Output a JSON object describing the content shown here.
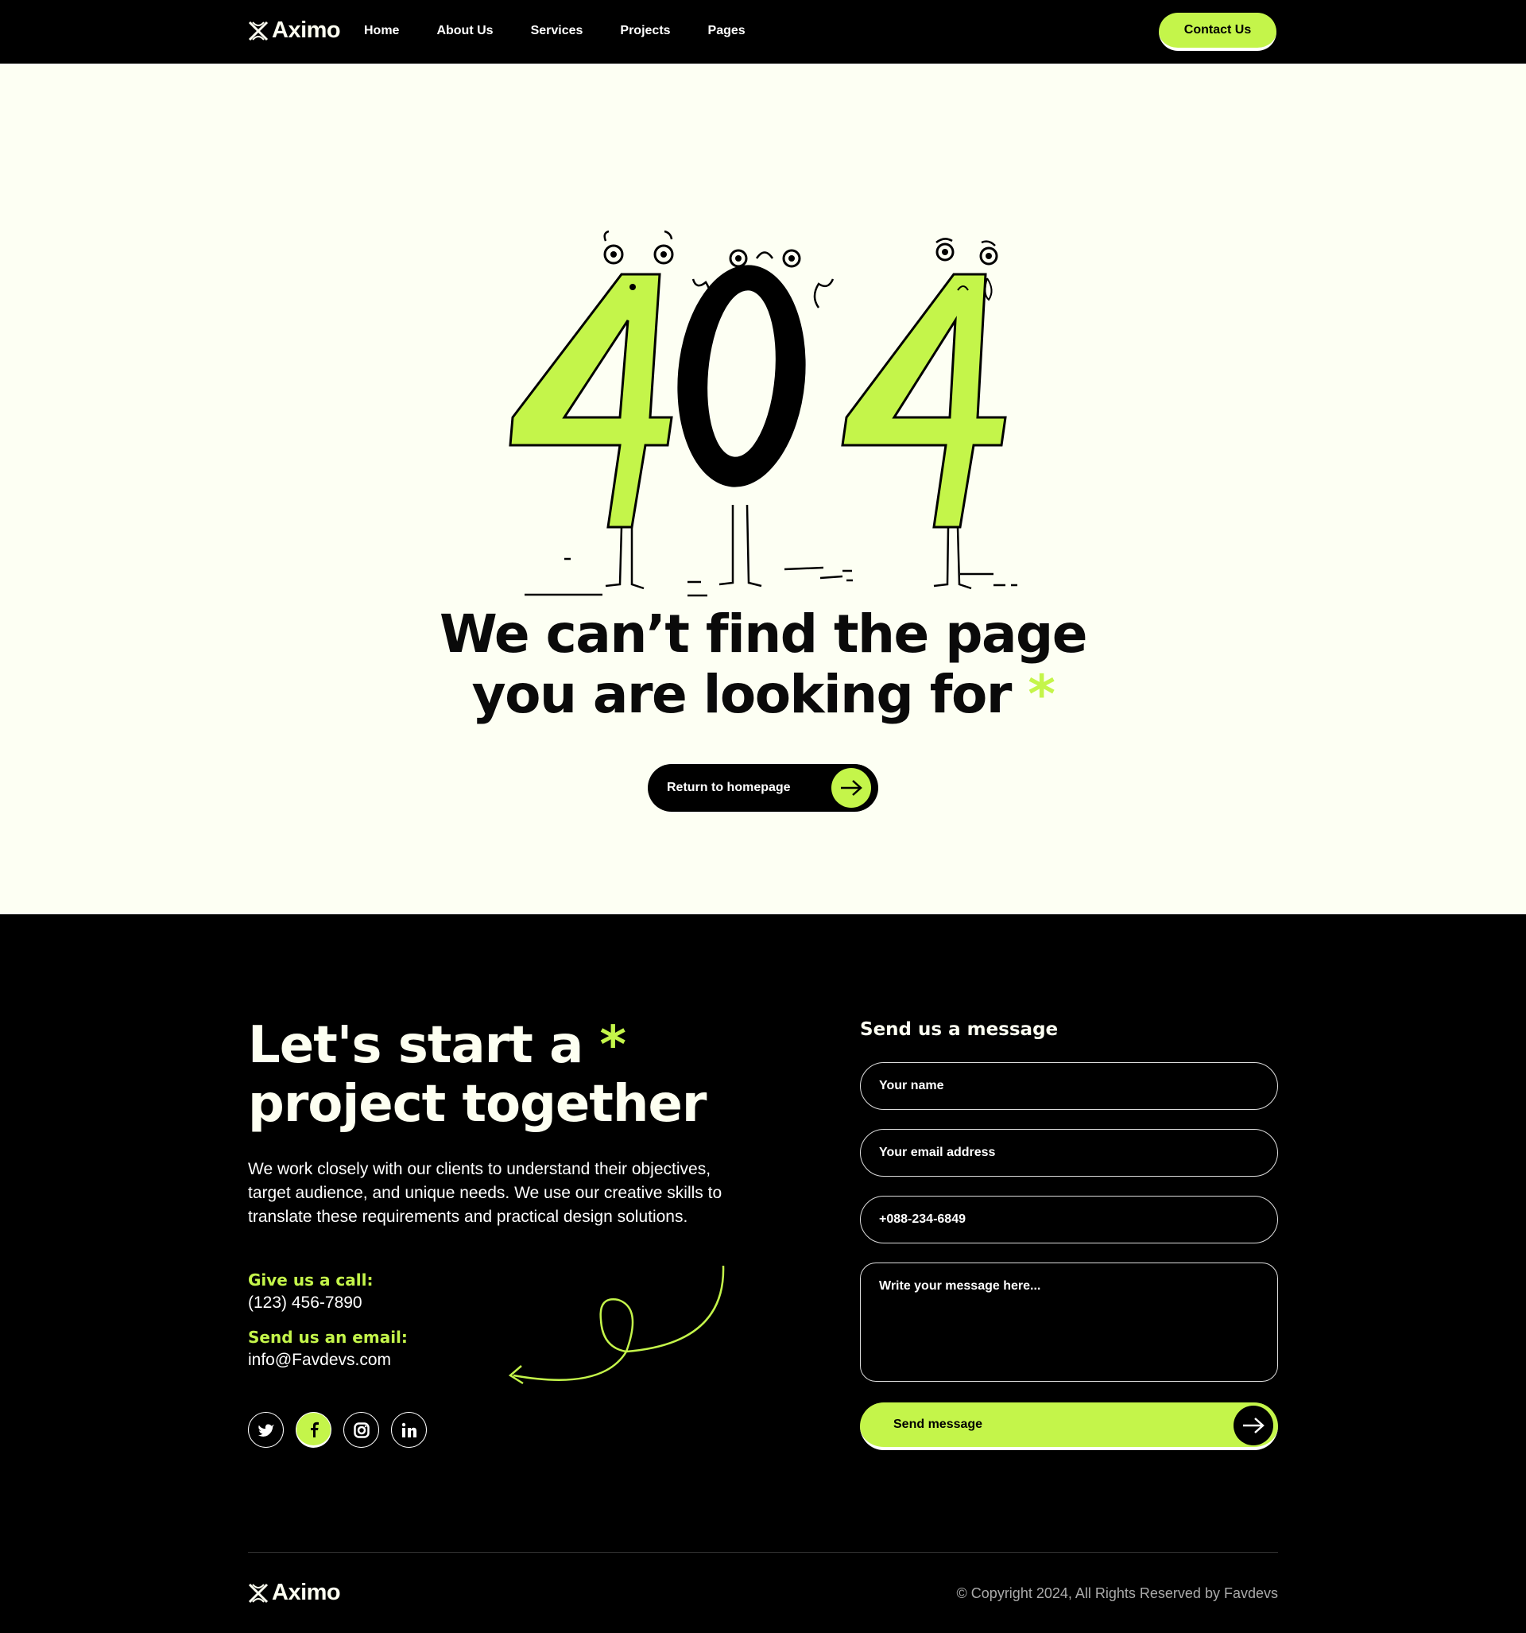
{
  "header": {
    "logo_text": "Aximo",
    "nav": [
      "Home",
      "About Us",
      "Services",
      "Projects",
      "Pages"
    ],
    "contact_label": "Contact Us"
  },
  "hero": {
    "illustration_text": "404",
    "headline_line1": "We can’t find the page",
    "headline_line2": "you are looking for",
    "asterisk": "*",
    "return_label": "Return to homepage"
  },
  "cta": {
    "title_line1": "Let's start a",
    "title_line2": "project together",
    "asterisk": "*",
    "description": "We work closely with our clients to understand their objectives, target audience, and unique needs. We use our creative skills to translate these requirements and practical design solutions.",
    "call_label": "Give us a call:",
    "call_value": "(123) 456-7890",
    "email_label": "Send us an email:",
    "email_value": "info@Favdevs.com",
    "socials": [
      "twitter-icon",
      "facebook-icon",
      "instagram-icon",
      "linkedin-icon"
    ]
  },
  "form": {
    "title": "Send us a message",
    "name_placeholder": "Your name",
    "email_placeholder": "Your email address",
    "phone_placeholder": "+088-234-6849",
    "message_placeholder": "Write your message here...",
    "send_label": "Send message"
  },
  "footer": {
    "logo_text": "Aximo",
    "copyright": "© Copyright 2024, All Rights Reserved by Favdevs"
  },
  "colors": {
    "accent": "#c4f54a",
    "dark": "#000000",
    "cream": "#fdfff3"
  }
}
